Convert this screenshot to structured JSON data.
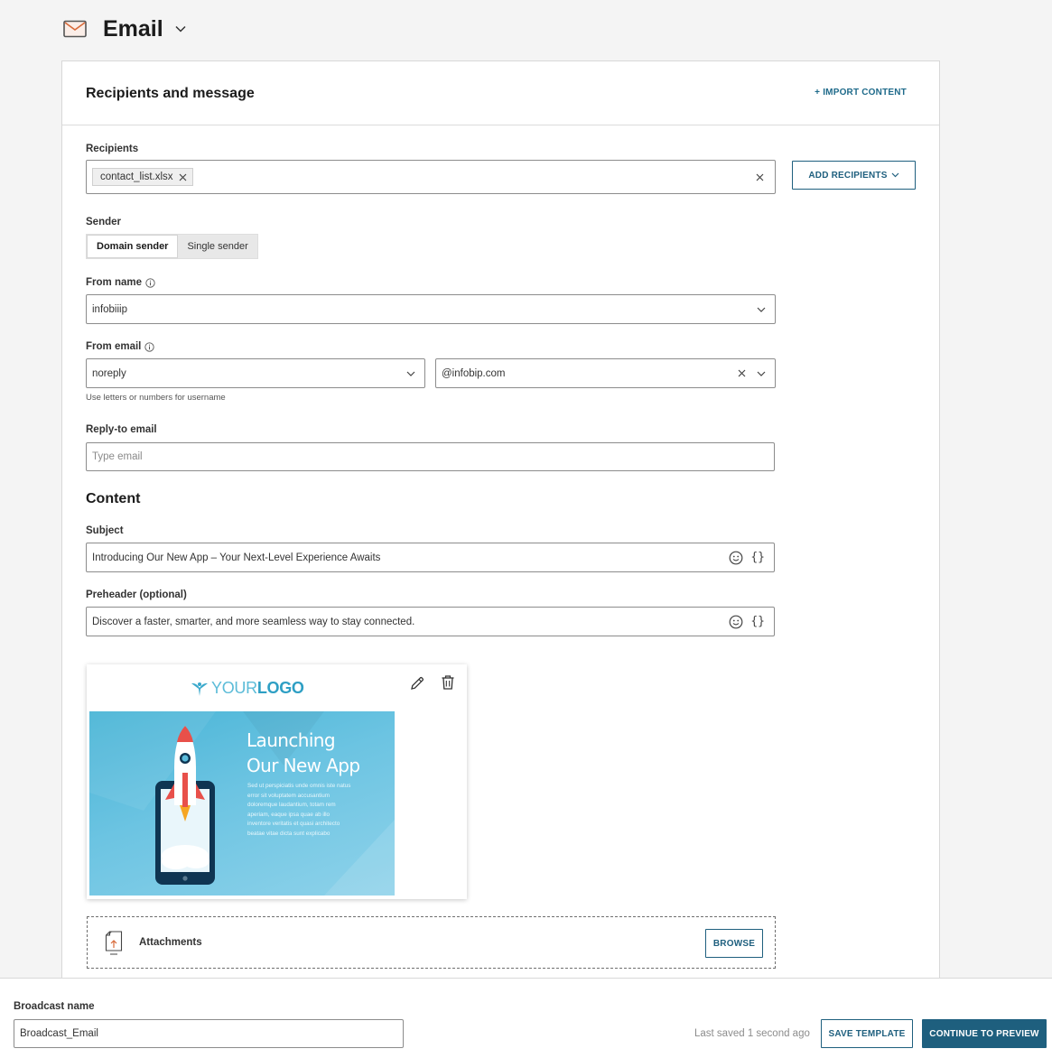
{
  "header": {
    "title": "Email",
    "icon": "envelope-icon"
  },
  "card": {
    "title": "Recipients and message",
    "import_label": "+ IMPORT CONTENT"
  },
  "recipients": {
    "label": "Recipients",
    "chip": "contact_list.xlsx",
    "add_label": "ADD RECIPIENTS"
  },
  "sender": {
    "label": "Sender",
    "options": [
      "Domain sender",
      "Single sender"
    ],
    "selected": "Domain sender"
  },
  "from_name": {
    "label": "From name",
    "value": "infobiiip"
  },
  "from_email": {
    "label": "From email",
    "username": "noreply",
    "domain": "@infobip.com",
    "hint": "Use letters or numbers for username"
  },
  "reply_to": {
    "label": "Reply-to email",
    "placeholder": "Type email"
  },
  "content": {
    "title": "Content",
    "subject_label": "Subject",
    "subject_value": "Introducing Our New App – Your Next-Level Experience Awaits",
    "preheader_label": "Preheader (optional)",
    "preheader_value": "Discover a faster, smarter, and more seamless way to stay connected."
  },
  "preview": {
    "logo_light": "YOUR",
    "logo_bold": "LOGO",
    "banner_line1": "Launching",
    "banner_line2": "Our New App",
    "banner_body": "Sed ut perspiciatis unde omnis iste natus error sit voluptatem accusantium doloremque laudantium, totam rem aperiam, eaque ipsa quae ab illo inventore veritatis et quasi architecto beatae vitae dicta sunt explicabo"
  },
  "attachments": {
    "label": "Attachments",
    "browse_label": "BROWSE"
  },
  "footer": {
    "name_label": "Broadcast name",
    "name_value": "Broadcast_Email",
    "saved_text": "Last saved 1 second ago",
    "save_template_label": "SAVE TEMPLATE",
    "continue_label": "CONTINUE TO PREVIEW"
  },
  "colors": {
    "accent": "#1e5f7e",
    "envelope": "#d86a3a",
    "banner": "#5bbcdc",
    "rocket_red": "#e8504a"
  }
}
